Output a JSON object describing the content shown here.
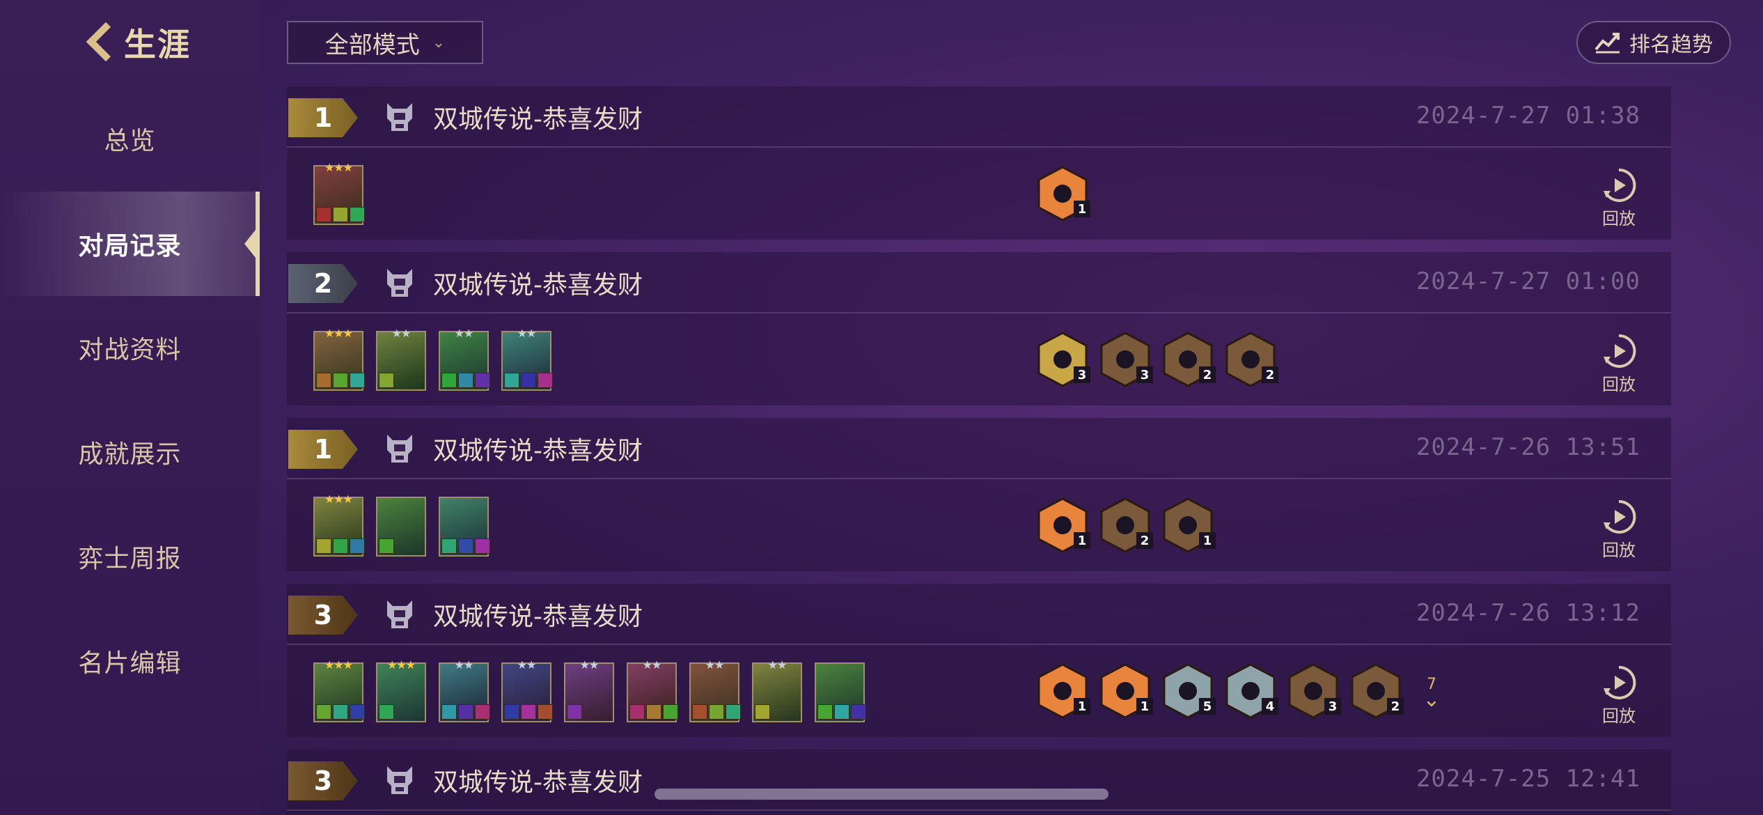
{
  "sidebar": {
    "back_title": "生涯",
    "items": [
      {
        "label": "总览"
      },
      {
        "label": "对局记录"
      },
      {
        "label": "对战资料"
      },
      {
        "label": "成就展示"
      },
      {
        "label": "弈士周报"
      },
      {
        "label": "名片编辑"
      }
    ],
    "active_index": 1
  },
  "toolbar": {
    "mode_select_value": "全部模式",
    "trend_button_label": "排名趋势"
  },
  "replay_label": "回放",
  "matches": [
    {
      "rank": "1",
      "rank_tier": "gold",
      "mode_name": "双城传说-恭喜发财",
      "time": "2024-7-27 01:38",
      "units": [
        {
          "stars": 3,
          "star_color": "gold"
        }
      ],
      "traits": [
        {
          "tier": "orange",
          "count": "1"
        }
      ],
      "more_count": ""
    },
    {
      "rank": "2",
      "rank_tier": "silver",
      "mode_name": "双城传说-恭喜发财",
      "time": "2024-7-27 01:00",
      "units": [
        {
          "stars": 3,
          "star_color": "gold"
        },
        {
          "stars": 2,
          "star_color": "silver"
        },
        {
          "stars": 2,
          "star_color": "silver"
        },
        {
          "stars": 2,
          "star_color": "silver"
        }
      ],
      "traits": [
        {
          "tier": "gold",
          "count": "3"
        },
        {
          "tier": "bronze",
          "count": "3"
        },
        {
          "tier": "bronze",
          "count": "2"
        },
        {
          "tier": "bronze",
          "count": "2"
        }
      ],
      "more_count": ""
    },
    {
      "rank": "1",
      "rank_tier": "gold",
      "mode_name": "双城传说-恭喜发财",
      "time": "2024-7-26 13:51",
      "units": [
        {
          "stars": 3,
          "star_color": "gold"
        },
        {
          "stars": 0,
          "star_color": "none"
        },
        {
          "stars": 0,
          "star_color": "none"
        }
      ],
      "traits": [
        {
          "tier": "orange",
          "count": "1"
        },
        {
          "tier": "bronze",
          "count": "2"
        },
        {
          "tier": "bronze",
          "count": "1"
        }
      ],
      "more_count": ""
    },
    {
      "rank": "3",
      "rank_tier": "bronze",
      "mode_name": "双城传说-恭喜发财",
      "time": "2024-7-26 13:12",
      "units": [
        {
          "stars": 3,
          "star_color": "gold"
        },
        {
          "stars": 3,
          "star_color": "gold"
        },
        {
          "stars": 2,
          "star_color": "silver"
        },
        {
          "stars": 2,
          "star_color": "silver"
        },
        {
          "stars": 2,
          "star_color": "silver"
        },
        {
          "stars": 2,
          "star_color": "silver"
        },
        {
          "stars": 2,
          "star_color": "silver"
        },
        {
          "stars": 2,
          "star_color": "silver"
        },
        {
          "stars": 0,
          "star_color": "none"
        }
      ],
      "traits": [
        {
          "tier": "orange",
          "count": "1"
        },
        {
          "tier": "orange",
          "count": "1"
        },
        {
          "tier": "silver",
          "count": "5"
        },
        {
          "tier": "silver",
          "count": "4"
        },
        {
          "tier": "bronze",
          "count": "3"
        },
        {
          "tier": "bronze",
          "count": "2"
        }
      ],
      "more_count": "7"
    },
    {
      "rank": "3",
      "rank_tier": "bronze",
      "mode_name": "双城传说-恭喜发财",
      "time": "2024-7-25 12:41",
      "units": [],
      "traits": [],
      "more_count": ""
    }
  ],
  "colors": {
    "trait_orange": "#e8843c",
    "trait_gold": "#c9a646",
    "trait_bronze": "#7a5a3a",
    "trait_silver": "#8fa3ab",
    "rank_gold": "#a88a3a",
    "rank_silver": "#5a6272",
    "rank_bronze": "#7a5830"
  }
}
